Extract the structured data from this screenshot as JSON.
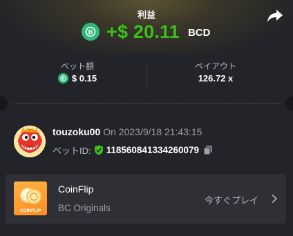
{
  "header": {
    "profit_label": "利益",
    "amount": "+$ 20.11",
    "currency": "BCD",
    "icons": {
      "coin": "bcd-coin-icon",
      "share": "share-icon"
    },
    "colors": {
      "amount": "#3bc117",
      "coin": "#2fb879"
    }
  },
  "stats": {
    "bet_amount_label": "ベット額",
    "bet_amount_value": "$ 0.15",
    "payout_label": "ペイアウト",
    "payout_value": "126.72 x"
  },
  "user": {
    "name": "touzoku00",
    "time": "On 2023/9/18 21:43:15",
    "bet_id_label": "ベットID:",
    "bet_id": "118560841334260079",
    "icons": {
      "verified": "shield-check-icon",
      "copy": "copy-icon"
    }
  },
  "game": {
    "name": "CoinFlip",
    "provider": "BC Originals",
    "play_label": "今すぐプレイ",
    "thumb_text": "COINFLIP"
  }
}
